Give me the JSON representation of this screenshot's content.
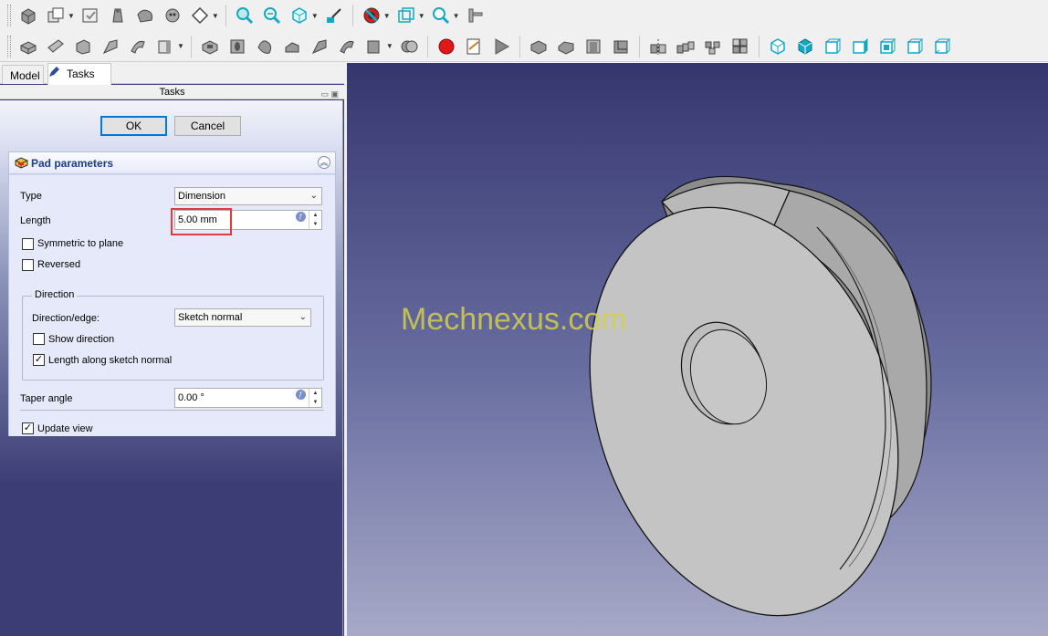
{
  "tabs": {
    "model": "Model",
    "tasks": "Tasks"
  },
  "tasks_header": "Tasks",
  "dialog": {
    "ok": "OK",
    "cancel": "Cancel"
  },
  "pad": {
    "title": "Pad parameters",
    "type_label": "Type",
    "type_value": "Dimension",
    "length_label": "Length",
    "length_value": "5.00 mm",
    "symmetric_label": "Symmetric to plane",
    "symmetric_checked": false,
    "reversed_label": "Reversed",
    "reversed_checked": false,
    "direction_group": "Direction",
    "direction_edge_label": "Direction/edge:",
    "direction_edge_value": "Sketch normal",
    "show_direction_label": "Show direction",
    "show_direction_checked": false,
    "along_normal_label": "Length along sketch normal",
    "along_normal_checked": true,
    "taper_label": "Taper angle",
    "taper_value": "0.00 °",
    "update_view_label": "Update view",
    "update_view_checked": true
  },
  "viewport": {
    "watermark": "Mechnexus.com"
  },
  "colors": {
    "viewport_top": "#35366e",
    "viewport_bottom": "#a7a9c7",
    "highlight": "#e03c3c",
    "panel_title": "#1b3f86",
    "record": "#e01818",
    "view_cube": "#13a8c4"
  },
  "toolbar_icons_row1": [
    "part-icon",
    "view-sketch-icon",
    "validate-sketch-icon",
    "sketch-shape-icon",
    "clone-icon",
    "sub-shape-icon",
    "sketch-plane-icon",
    "fit-all-icon",
    "fit-selection-icon",
    "draw-style-icon",
    "std-view-menu-icon",
    "measure-icon",
    "bounding-box-icon",
    "zoom-icon",
    "caliper-icon"
  ],
  "toolbar_icons_row2": [
    "pad-icon",
    "pocket-icon",
    "revolution-icon",
    "loft-icon",
    "sweep-icon",
    "body-icon",
    "pocket2-icon",
    "hole-icon",
    "groove-icon",
    "subtractive-loft-icon",
    "subtractive-pipe-icon",
    "subtractive-helix-icon",
    "boolean-icon",
    "macro-record-icon",
    "macro-edit-icon",
    "macro-run-icon",
    "fillet-icon",
    "chamfer-icon",
    "draft-icon",
    "thickness-icon",
    "mirror-icon",
    "linear-pattern-icon",
    "polar-pattern-icon",
    "multitransform-icon",
    "view-iso-icon",
    "view-front-icon",
    "view-top-icon",
    "view-right-icon",
    "view-rear-icon",
    "view-bottom-icon",
    "view-left-icon"
  ]
}
